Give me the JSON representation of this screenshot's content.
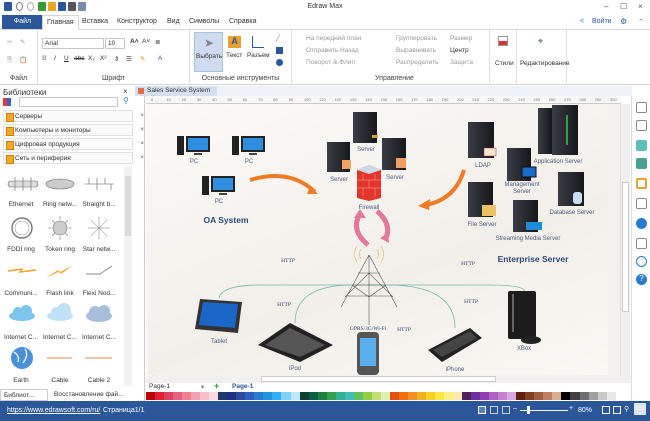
{
  "app": {
    "title": "Edraw Max"
  },
  "menu": {
    "file": "Файл",
    "tabs": [
      "Главная",
      "Вставка",
      "Конструктор",
      "Вид",
      "Символы",
      "Справка"
    ],
    "login": "Войти"
  },
  "ribbon": {
    "font_name": "Arial",
    "font_size": "10",
    "groups": {
      "file": "Файл",
      "font": "Шрифт",
      "tools": "Основные инструменты",
      "manage": "Управление",
      "styles": "Стили",
      "edit": "Редактирование"
    },
    "tools": {
      "select": "Выбрать",
      "text": "Текст",
      "connector": "Разъем"
    },
    "manage": {
      "front": "На передний план",
      "back": "Отправить Назад",
      "rotate": "Поворот & Флип",
      "group": "Группировать",
      "align": "Выравнивать",
      "distribute": "Распределить",
      "size": "Размер",
      "center": "Центр",
      "protect": "Защита"
    },
    "styles": "Стили",
    "edit": "Редактирование",
    "format_buttons": [
      "B",
      "I",
      "U",
      "abc",
      "X₂",
      "X²",
      "A"
    ]
  },
  "library": {
    "title": "Библиотеки",
    "categories": [
      "Серверы",
      "Компьютеры и мониторы",
      "Цифровая продукция",
      "Сеть и периферия"
    ],
    "shapes": [
      "Ethernet",
      "Ring netw...",
      "Straight b...",
      "FDDI ring",
      "Token ring",
      "Star netw...",
      "Communi...",
      "Flash link",
      "Flexi Nod...",
      "Internet C...",
      "Internet C...",
      "Internet C...",
      "Earth",
      "Cable",
      "Cable 2"
    ],
    "bottom_tabs": [
      "Библиот...",
      "Восстановление фай..."
    ]
  },
  "document": {
    "tab": "Sales Service System",
    "ruler_ticks": [
      "0",
      "10",
      "20",
      "30",
      "40",
      "50",
      "60",
      "70",
      "80",
      "90",
      "100",
      "110",
      "120",
      "130",
      "140",
      "150",
      "160",
      "170",
      "180",
      "190",
      "200",
      "210",
      "220",
      "230",
      "240",
      "250",
      "260",
      "270",
      "280",
      "290",
      "300"
    ]
  },
  "diagram": {
    "labels": {
      "pc1": "PC",
      "pc2": "PC",
      "pc3": "PC",
      "oa": "OA System",
      "server_top": "Server",
      "server_left": "Server",
      "server_right": "Server",
      "firewall": "Firewall",
      "ldap": "LDAP",
      "app_server": "Application Server",
      "mgmt1": "Management",
      "mgmt2": "Server",
      "db": "Database Server",
      "file": "File Server",
      "streaming": "Streaming Media Server",
      "enterprise": "Enterprise Server",
      "tablet": "Tablet",
      "ipod": "iPod",
      "iphone": "iPhone",
      "xbox": "XBox",
      "gprs": "GPRS/3G/Wi-Fi"
    },
    "http": [
      "HTTP",
      "HTTP",
      "HTTP",
      "HTTP",
      "HTTP"
    ]
  },
  "pages": {
    "selector": "Page-1",
    "tab": "Page-1"
  },
  "status": {
    "url": "https://www.edrawsoft.com/ru/",
    "page": "Страница1/1",
    "zoom": "80%"
  },
  "colors": {
    "accent": "#2b579a"
  }
}
